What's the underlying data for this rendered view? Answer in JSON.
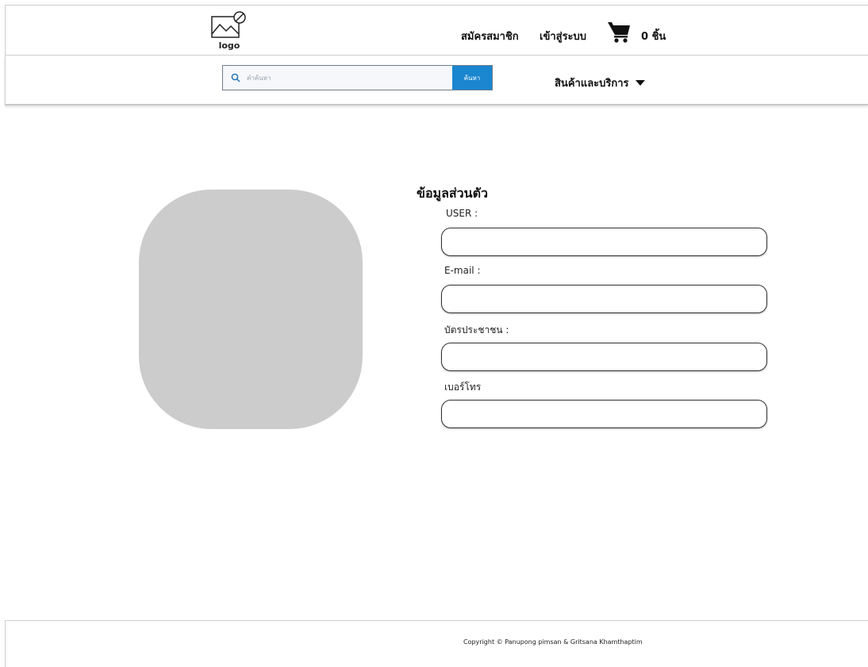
{
  "header": {
    "logo_text": "logo",
    "register_label": "สมัครสมาชิก",
    "login_label": "เข้าสู่ระบบ",
    "cart_count_label": "0 ชิ้น"
  },
  "search": {
    "placeholder": "คำค้นหา",
    "button_label": "ค้นหา"
  },
  "nav": {
    "products_menu_label": "สินค้าและบริการ"
  },
  "profile": {
    "title": "ข้อมูลส่วนตัว",
    "fields": [
      {
        "label": "USER :",
        "value": ""
      },
      {
        "label": "E-mail :",
        "value": ""
      },
      {
        "label": "บัตรประชาชน :",
        "value": ""
      },
      {
        "label": "เบอร์โทร",
        "value": ""
      }
    ]
  },
  "footer": {
    "copyright": "Copyright © Panupong pimsan & Gritsana Khamthaptim"
  },
  "colors": {
    "search_button": "#1a86d0",
    "avatar_placeholder": "#cccccc"
  }
}
